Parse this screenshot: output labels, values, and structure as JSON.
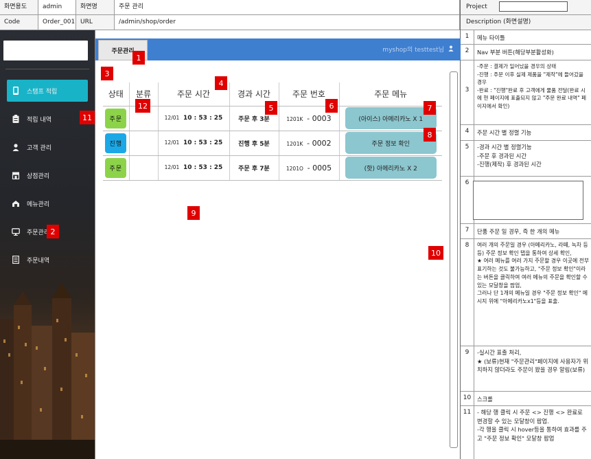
{
  "meta": {
    "screen_usage_label": "화면용도",
    "screen_usage_value": "admin",
    "screen_name_label": "화면명",
    "screen_name_value": "주문 관리",
    "code_label": "Code",
    "code_value": "Order_001",
    "url_label": "URL",
    "url_value": "/admin/shop/order"
  },
  "right_panel": {
    "project_label": "Project",
    "description_label": "Description (화면설명)",
    "items": [
      {
        "num": "1",
        "text": "메뉴 타이틀"
      },
      {
        "num": "2",
        "text": "Nav 부분 버튼(해당부분활성화)"
      },
      {
        "num": "3",
        "text": "-주문 : 결제가 일어났을 경우의 상태\n-진행 : 주문 이후 실제 제품을 \"제작\"에 들어갔을 경우\n-완료 : \"진행\"완료 후 고객에게 물품 전달(완료 시에 현 페이지에 표출되지 않고 \"주문 완료 내역\" 페이지에서 확인)"
      },
      {
        "num": "4",
        "text": "주문 시간 별 정렬 기능"
      },
      {
        "num": "5",
        "text": "-경과 시간 별 정렬기능\n-주문 후 경과된 시간\n-진행(제작) 후 경과된 시간"
      },
      {
        "num": "6",
        "text": ""
      },
      {
        "num": "7",
        "text": "단품 주문 일 경우, 즉 한 개의 메뉴"
      },
      {
        "num": "8",
        "text": "여러 개의 주문일 경우 (아메리카노, 라떼, 녹차 등등) 주문 정보 확인 탭을 통하여 상세 확인,\n★ 여러 메뉴를 여러 가지 주문할 경우 이곳에 전부 표기하는 것도 불가능하고, \"주문 정보 확인\"이라는 버튼을 클릭하여 여러 메뉴의 주문을 확인할 수 있는 모달창을 팝업,\n그러나 단 1개의 메뉴일 경우 \"주문 정보 확인\" 메시지 위에 \"아메리카노x1\"등을 표출."
      },
      {
        "num": "9",
        "text": "-실시간 표출 처리,\n★ (보류)현재 \"주문관리\"페이지에 사용자가 위치하지 않더라도 주문이 왔을 경우 알림(보류)"
      },
      {
        "num": "10",
        "text": "스크롤"
      },
      {
        "num": "11",
        "text": "- 해당 행 클릭 시 주문 <> 진행 <> 완료로 변경할 수 있는 모달창이 팝업.\n-각 행을 클릭 시 hover등을 통하여 효과를 주고 \"주문 정보 확인\" 모달창 팝업"
      }
    ]
  },
  "sidebar": {
    "items": [
      {
        "label": "스탬프 적립",
        "icon": "phone-icon",
        "active": true
      },
      {
        "label": "적립 내역",
        "icon": "clipboard-icon",
        "active": false
      },
      {
        "label": "고객 관리",
        "icon": "user-icon",
        "active": false
      },
      {
        "label": "상점관리",
        "icon": "store-icon",
        "active": false
      },
      {
        "label": "메뉴관리",
        "icon": "menu-icon",
        "active": false
      },
      {
        "label": "주문관리",
        "icon": "monitor-icon",
        "active": false
      },
      {
        "label": "주문내역",
        "icon": "list-icon",
        "active": false
      }
    ]
  },
  "main": {
    "tab_label": "주문관리",
    "user_text": "myshop의 testtest님",
    "table": {
      "headers": [
        "상태",
        "분류",
        "주문 시간",
        "경과 시간",
        "주문 번호",
        "주문 메뉴"
      ],
      "rows": [
        {
          "status": "주문",
          "status_color": "#8cd34a",
          "category": "",
          "date": "12/01",
          "time": "10 : 53 : 25",
          "elapsed": "주문 후 3분",
          "order_prefix": "1201K",
          "order_no": "- 0003",
          "menu": "(아이스) 아메리카노 X 1"
        },
        {
          "status": "진행",
          "status_color": "#1ca8e6",
          "category": "",
          "date": "12/01",
          "time": "10 : 53 : 25",
          "elapsed": "진행 후 5분",
          "order_prefix": "1201K",
          "order_no": "- 0002",
          "menu": "주문 정보 확인"
        },
        {
          "status": "주문",
          "status_color": "#8cd34a",
          "category": "",
          "date": "12/01",
          "time": "10 : 53 : 25",
          "elapsed": "주문 후 7분",
          "order_prefix": "1201O",
          "order_no": "- 0005",
          "menu": "(핫) 아메리카노 X 2"
        }
      ]
    }
  },
  "markers": [
    "1",
    "2",
    "3",
    "4",
    "5",
    "6",
    "7",
    "8",
    "9",
    "10",
    "11",
    "12"
  ],
  "colors": {
    "accent": "#19b3c8",
    "topbar": "#3f7fd0",
    "marker": "#e00000",
    "menu_button": "#8cc6ce"
  }
}
